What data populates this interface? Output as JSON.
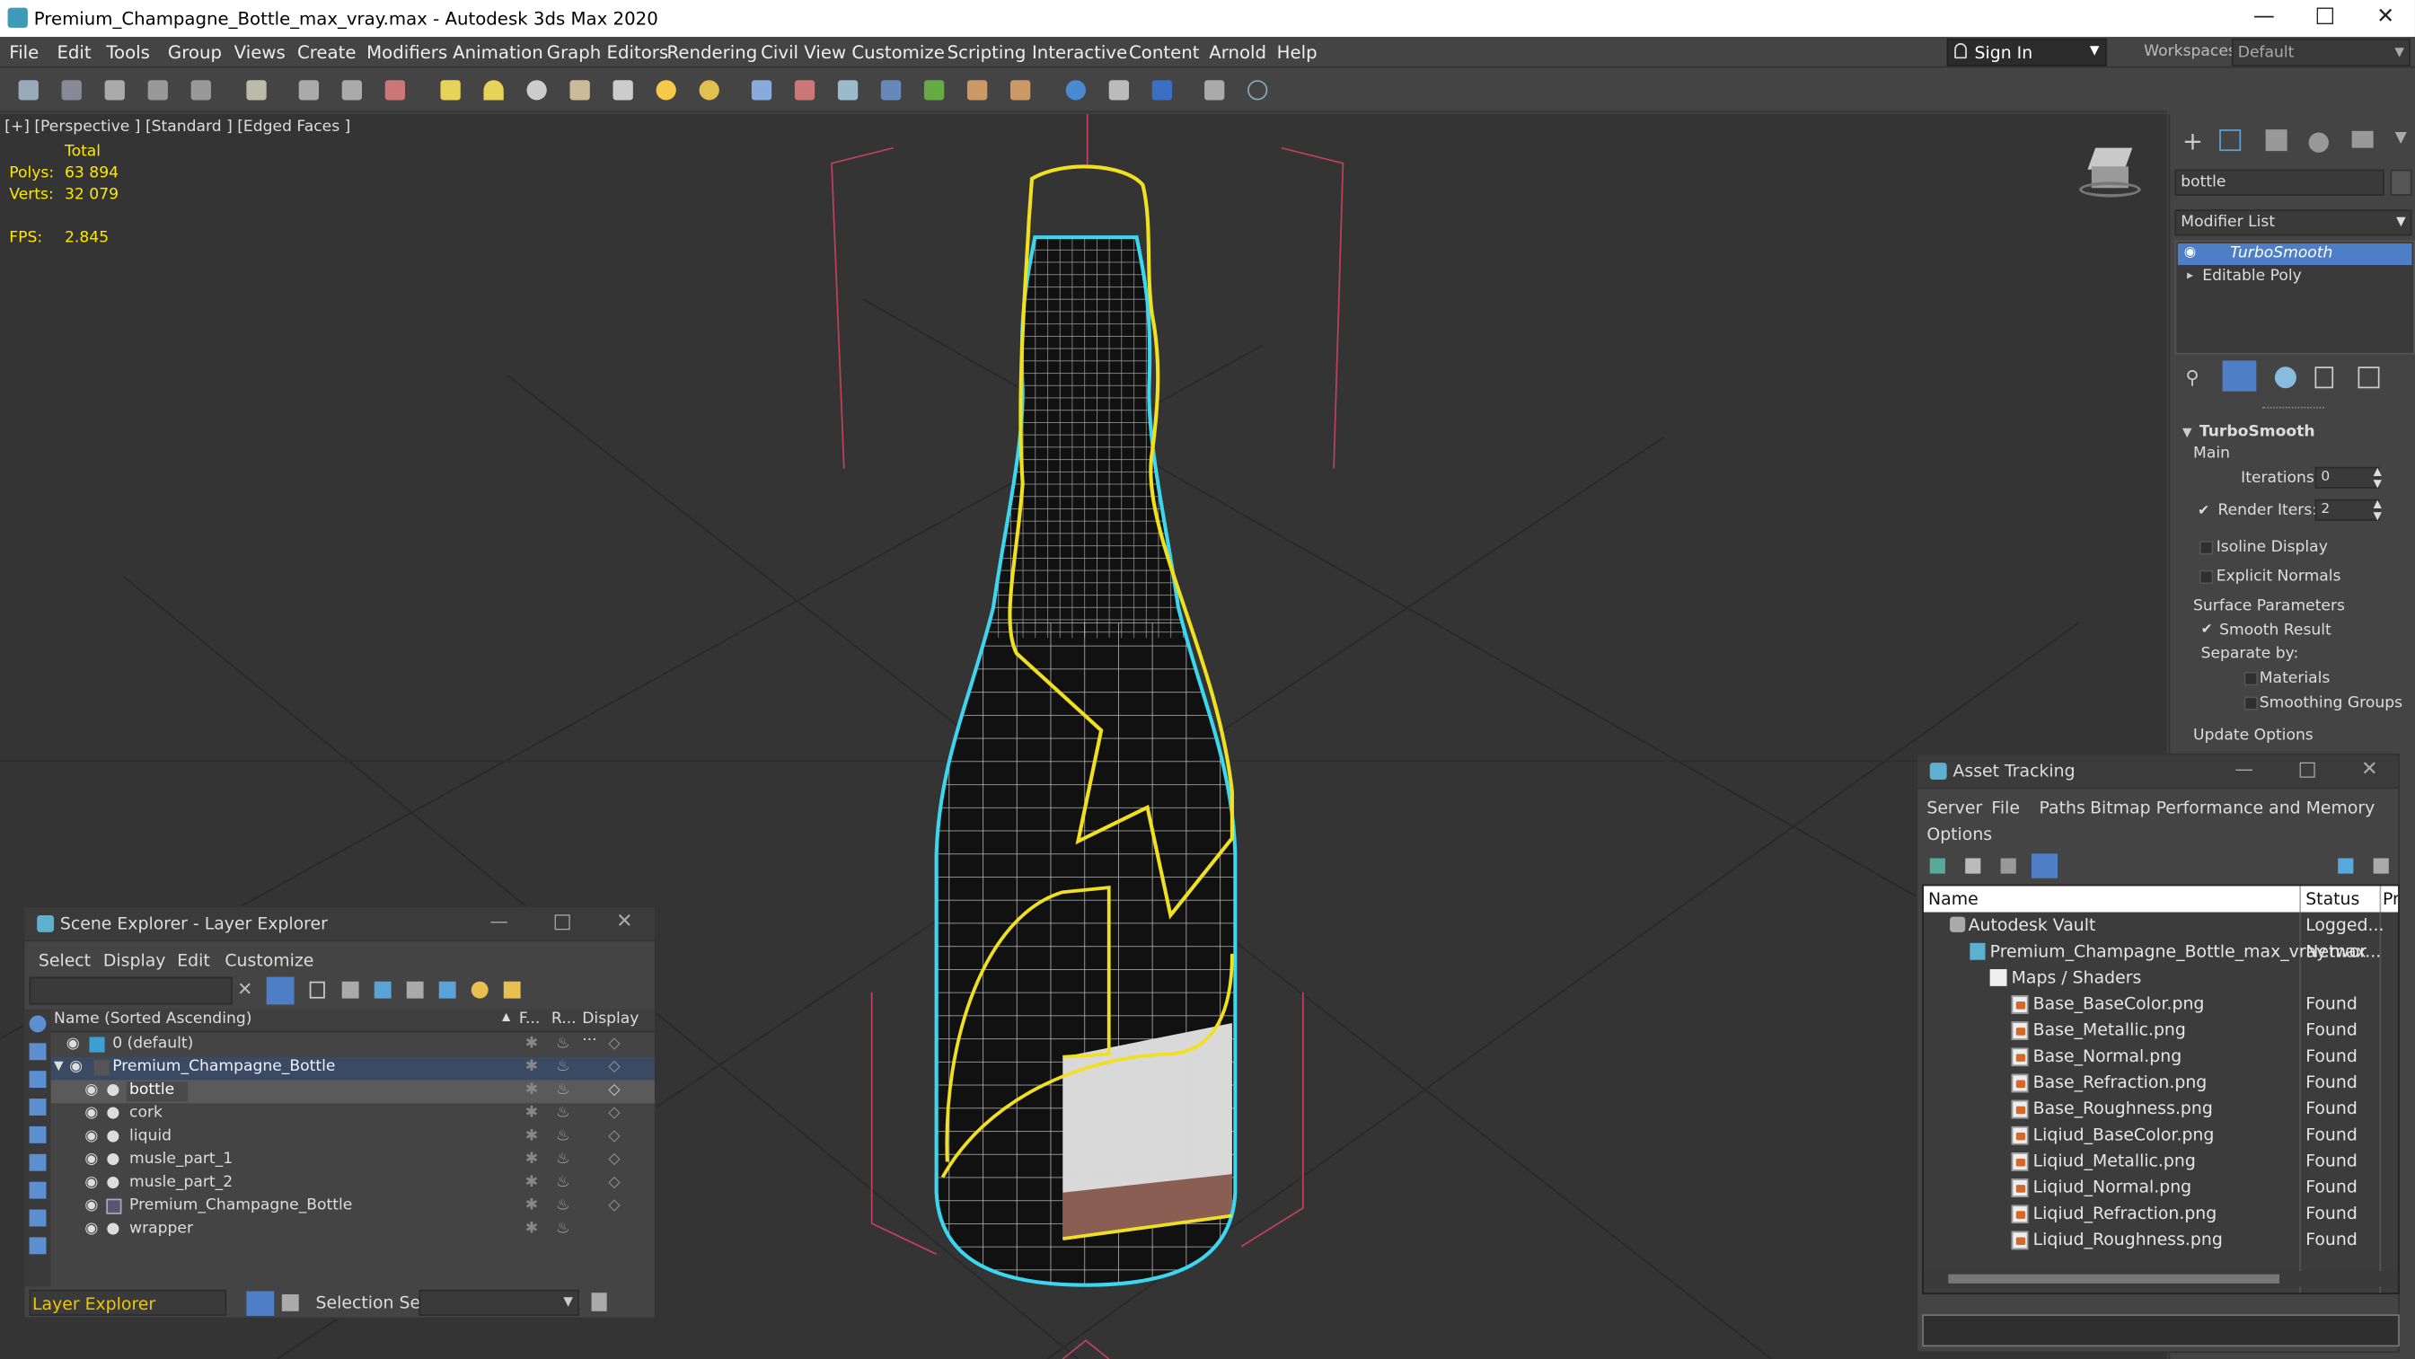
{
  "app": {
    "title": "Premium_Champagne_Bottle_max_vray.max - Autodesk 3ds Max 2020",
    "menu": [
      "File",
      "Edit",
      "Tools",
      "Group",
      "Views",
      "Create",
      "Modifiers",
      "Animation",
      "Graph Editors",
      "Rendering",
      "Civil View",
      "Customize",
      "Scripting",
      "Interactive",
      "Content",
      "Arnold",
      "Help"
    ],
    "sign_in": "Sign In",
    "workspaces_label": "Workspaces:",
    "workspace": "Default"
  },
  "viewport": {
    "label": "[+] [Perspective ]  [Standard ] [Edged Faces ]",
    "stats_total": "Total",
    "polys_label": "Polys:",
    "polys": "63 894",
    "verts_label": "Verts:",
    "verts": "32 079",
    "fps_label": "FPS:",
    "fps": "2.845"
  },
  "command_panel": {
    "object_name": "bottle",
    "modifier_list": "Modifier List",
    "stack": [
      "TurboSmooth",
      "Editable Poly"
    ],
    "rollout": "TurboSmooth",
    "main": "Main",
    "iterations_label": "Iterations:",
    "iterations": "0",
    "render_iters_label": "Render Iters:",
    "render_iters": "2",
    "isoline": "Isoline Display",
    "explicit_normals": "Explicit Normals",
    "surface_params": "Surface Parameters",
    "smooth_result": "Smooth Result",
    "separate_by": "Separate by:",
    "materials": "Materials",
    "smoothing_groups": "Smoothing Groups",
    "update_options": "Update Options"
  },
  "scene_explorer": {
    "title": "Scene Explorer - Layer Explorer",
    "menu": [
      "Select",
      "Display",
      "Edit",
      "Customize"
    ],
    "col_name": "Name (Sorted Ascending)",
    "col_f": "F...",
    "col_r": "R...",
    "col_display": "Display ...",
    "rows": [
      "0 (default)",
      "Premium_Champagne_Bottle",
      "bottle",
      "cork",
      "liquid",
      "musle_part_1",
      "musle_part_2",
      "Premium_Champagne_Bottle",
      "wrapper"
    ],
    "footer_layer": "Layer Explorer",
    "selection_set_label": "Selection Set:"
  },
  "asset_tracking": {
    "title": "Asset Tracking",
    "menu": [
      "Server",
      "File",
      "Paths",
      "Bitmap Performance and Memory",
      "Options"
    ],
    "col_name": "Name",
    "col_status": "Status",
    "col_p": "Pr",
    "rows": [
      {
        "name": "Autodesk Vault",
        "status": "Logged..."
      },
      {
        "name": "Premium_Champagne_Bottle_max_vray.max",
        "status": "Networ..."
      },
      {
        "name": "Maps / Shaders",
        "status": ""
      },
      {
        "name": "Base_BaseColor.png",
        "status": "Found"
      },
      {
        "name": "Base_Metallic.png",
        "status": "Found"
      },
      {
        "name": "Base_Normal.png",
        "status": "Found"
      },
      {
        "name": "Base_Refraction.png",
        "status": "Found"
      },
      {
        "name": "Base_Roughness.png",
        "status": "Found"
      },
      {
        "name": "Liqiud_BaseColor.png",
        "status": "Found"
      },
      {
        "name": "Liqiud_Metallic.png",
        "status": "Found"
      },
      {
        "name": "Liqiud_Normal.png",
        "status": "Found"
      },
      {
        "name": "Liqiud_Refraction.png",
        "status": "Found"
      },
      {
        "name": "Liqiud_Roughness.png",
        "status": "Found"
      }
    ]
  }
}
